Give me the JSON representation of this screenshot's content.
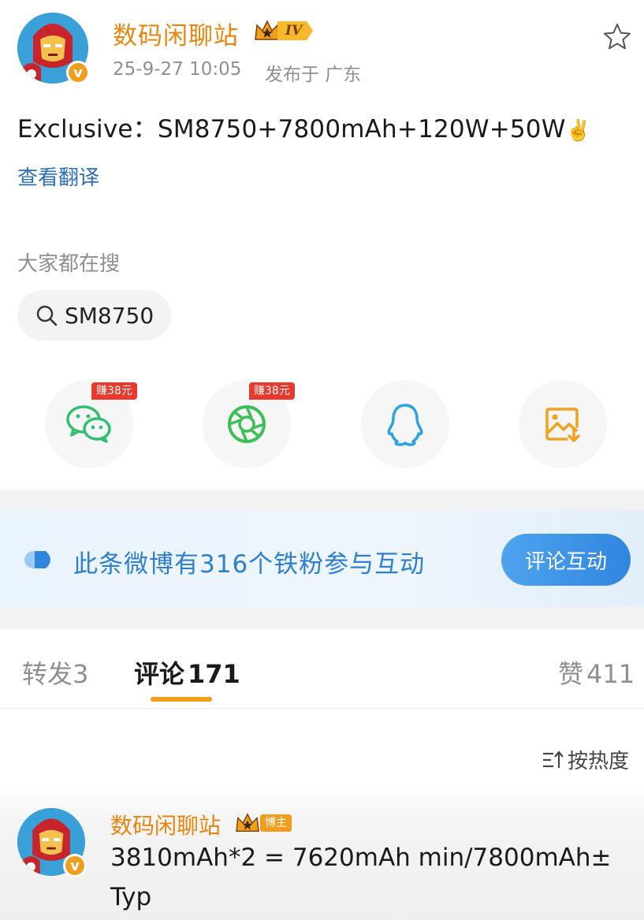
{
  "post": {
    "author": "数码闲聊站",
    "level_badge": "IV",
    "timestamp": "25-9-27 10:05",
    "location": "发布于 广东",
    "text": "Exclusive：SM8750+7800mAh+120W+50W",
    "emoji": "✌️",
    "translate_label": "查看翻译"
  },
  "search": {
    "heading": "大家都在搜",
    "chip": "SM8750"
  },
  "share": {
    "wechat_badge": "赚38元",
    "moments_badge": "赚38元",
    "icons": [
      "wechat-icon",
      "moments-icon",
      "qq-icon",
      "save-image-icon"
    ]
  },
  "banner": {
    "text": "此条微博有316个铁粉参与互动",
    "button": "评论互动"
  },
  "tabs": {
    "repost": "转发",
    "repost_count": "3",
    "comment": "评论",
    "comment_count": "171",
    "like": "赞",
    "like_count": "411"
  },
  "sort_label": "按热度",
  "comment": {
    "author": "数码闲聊站",
    "role_tag": "博主",
    "line1": "3810mAh*2 = 7620mAh min/7800mAh±",
    "line2": "Typ"
  },
  "colors": {
    "accent_orange": "#e8850f",
    "link_blue": "#2d6fb3",
    "banner_blue": "#2f7fcf",
    "badge_red": "#e8392c"
  }
}
